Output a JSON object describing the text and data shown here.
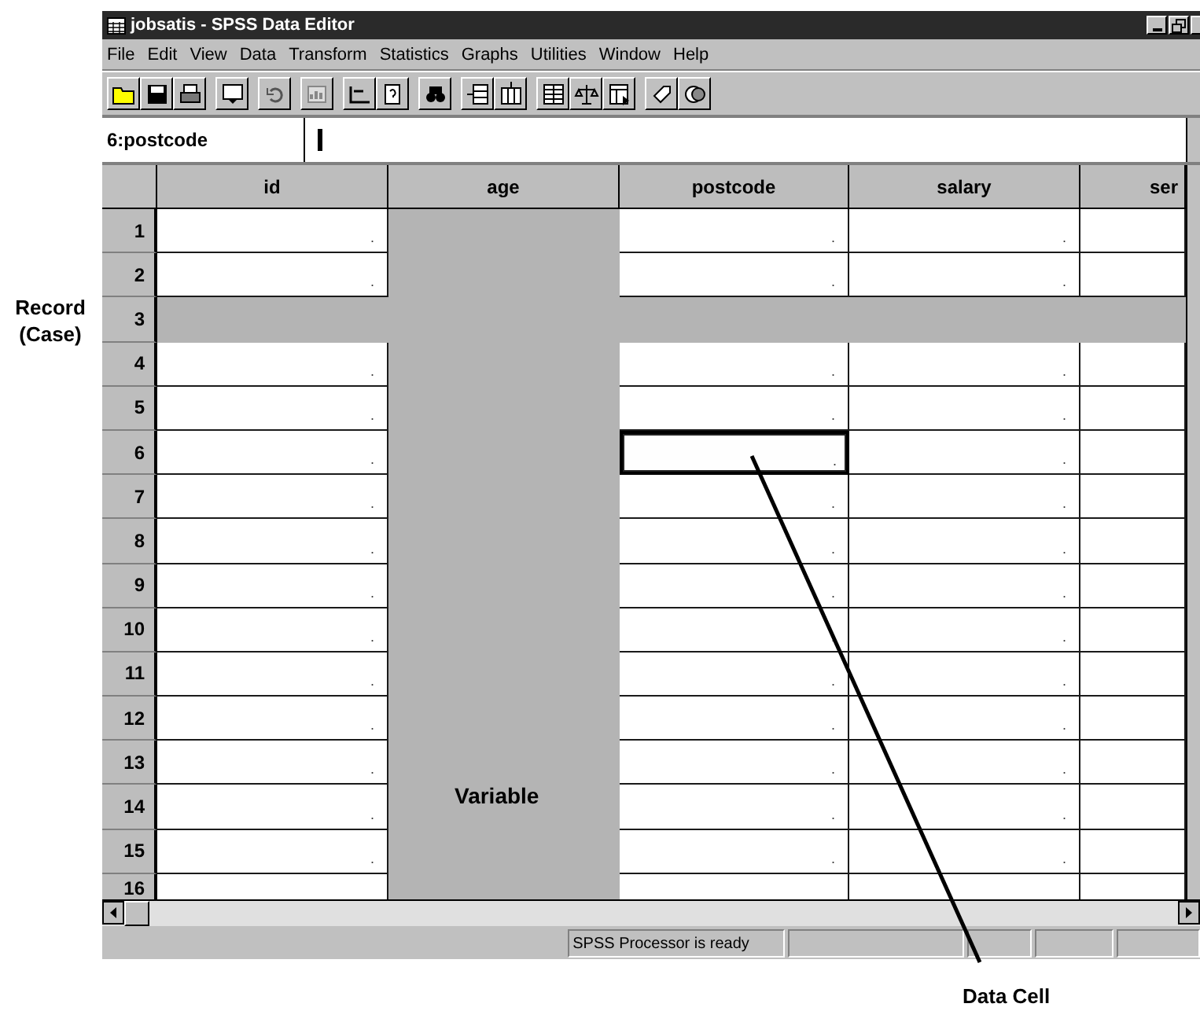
{
  "window": {
    "title": "jobsatis - SPSS Data Editor"
  },
  "menu": [
    {
      "label": "File"
    },
    {
      "label": "Edit"
    },
    {
      "label": "View"
    },
    {
      "label": "Data"
    },
    {
      "label": "Transform"
    },
    {
      "label": "Statistics"
    },
    {
      "label": "Graphs"
    },
    {
      "label": "Utilities"
    },
    {
      "label": "Window"
    },
    {
      "label": "Help"
    }
  ],
  "cell_editor": {
    "reference": "6:postcode"
  },
  "grid": {
    "columns": [
      {
        "name": "id",
        "selected": false,
        "active": false
      },
      {
        "name": "age",
        "selected": true,
        "active": false
      },
      {
        "name": "postcode",
        "selected": false,
        "active": true
      },
      {
        "name": "salary",
        "selected": false,
        "active": false
      },
      {
        "name": "ser",
        "selected": false,
        "active": false
      }
    ],
    "rows": [
      {
        "label": "1",
        "selected": false,
        "active": false,
        "cells": [
          ".",
          null,
          ".",
          ".",
          null
        ]
      },
      {
        "label": "2",
        "selected": false,
        "active": false,
        "cells": [
          ".",
          null,
          ".",
          ".",
          null
        ]
      },
      {
        "label": "3",
        "selected": true,
        "active": false,
        "cells": [
          null,
          null,
          null,
          null,
          null
        ]
      },
      {
        "label": "4",
        "selected": false,
        "active": false,
        "cells": [
          ".",
          null,
          ".",
          ".",
          null
        ]
      },
      {
        "label": "5",
        "selected": false,
        "active": false,
        "cells": [
          ".",
          null,
          ".",
          ".",
          null
        ]
      },
      {
        "label": "6",
        "selected": false,
        "active": true,
        "cells": [
          ".",
          null,
          ".",
          ".",
          null
        ]
      },
      {
        "label": "7",
        "selected": false,
        "active": false,
        "cells": [
          ".",
          null,
          ".",
          ".",
          null
        ]
      },
      {
        "label": "8",
        "selected": false,
        "active": false,
        "cells": [
          ".",
          null,
          ".",
          ".",
          null
        ]
      },
      {
        "label": "9",
        "selected": false,
        "active": false,
        "cells": [
          ".",
          null,
          ".",
          ".",
          null
        ]
      },
      {
        "label": "10",
        "selected": false,
        "active": false,
        "cells": [
          ".",
          null,
          ".",
          ".",
          null
        ]
      },
      {
        "label": "11",
        "selected": false,
        "active": false,
        "cells": [
          ".",
          null,
          ".",
          ".",
          null
        ]
      },
      {
        "label": "12",
        "selected": false,
        "active": false,
        "cells": [
          ".",
          null,
          ".",
          ".",
          null
        ]
      },
      {
        "label": "13",
        "selected": false,
        "active": false,
        "cells": [
          ".",
          null,
          ".",
          ".",
          null
        ]
      },
      {
        "label": "14",
        "selected": false,
        "active": false,
        "cells": [
          ".",
          null,
          ".",
          ".",
          null
        ]
      },
      {
        "label": "15",
        "selected": false,
        "active": false,
        "cells": [
          ".",
          null,
          ".",
          ".",
          null
        ]
      },
      {
        "label": "16",
        "selected": false,
        "active": false,
        "cells": [
          null,
          null,
          null,
          null,
          null
        ]
      }
    ]
  },
  "status_bar": {
    "message": "SPSS Processor is ready"
  },
  "annotations": {
    "record": "Record\n(Case)",
    "variable": "Variable",
    "data_cell": "Data Cell"
  }
}
